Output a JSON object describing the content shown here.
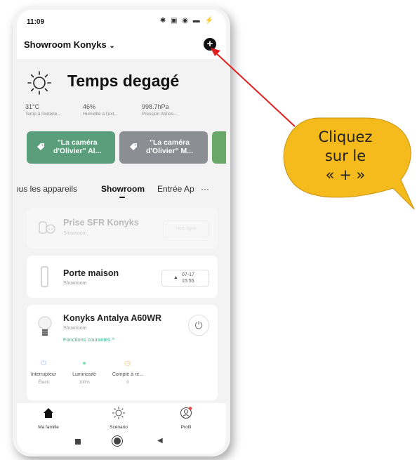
{
  "status_bar": {
    "time": "11:09",
    "icons": "✱ ▣ ◉ ▬ ⚡"
  },
  "header": {
    "home_name": "Showroom Konyks",
    "add_label": "+"
  },
  "weather": {
    "title": "Temps degagé",
    "stats": [
      {
        "value": "31°C",
        "label": "Temp à l'extérie..."
      },
      {
        "value": "46%",
        "label": "Humidité à l'ext..."
      },
      {
        "value": "998.7hPa",
        "label": "Pression Atmos..."
      }
    ]
  },
  "scenes": [
    {
      "label_line1": "\"La caméra",
      "label_line2": "d'Olivier\" Al...",
      "color": "#5a9e7b"
    },
    {
      "label_line1": "\"La caméra",
      "label_line2": "d'Olivier\" M...",
      "color": "#8b8f94"
    }
  ],
  "tabs": {
    "all": "Tous les appareils",
    "showroom": "Showroom",
    "entree": "Entrée Ap",
    "more": "···"
  },
  "devices": [
    {
      "name": "Prise SFR Konyks",
      "room": "Showroom",
      "status": "Hors ligne"
    },
    {
      "name": "Porte maison",
      "room": "Showroom",
      "date": "07-17",
      "time": "15:55"
    },
    {
      "name": "Konyks Antalya A60WR",
      "room": "Showroom",
      "functions": "Fonctions courantes ^",
      "controls": [
        {
          "label": "Interrupteur",
          "value": "Éteint"
        },
        {
          "label": "Luminosité",
          "value": "100%"
        },
        {
          "label": "Compte à re...",
          "value": "0"
        }
      ]
    }
  ],
  "bottom_nav": {
    "home": "Ma famille",
    "scenario": "Scénario",
    "profile": "Profil"
  },
  "callout": {
    "line1": "Cliquez",
    "line2": "sur le",
    "line3": "« + »",
    "color": "#f5bb1c"
  },
  "colors": {
    "accent_green": "#2fb38a",
    "arrow_red": "#e02020"
  }
}
